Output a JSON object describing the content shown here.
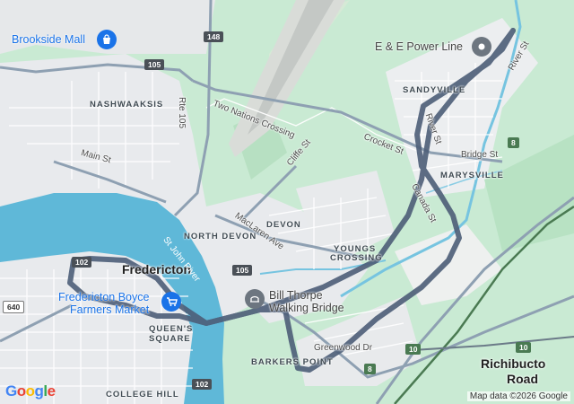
{
  "map": {
    "places": {
      "brookside_mall": "Brookside Mall",
      "ee_power_line": "E & E Power Line",
      "fredericton_boyce_line1": "Fredericton Boyce",
      "fredericton_boyce_line2": "Farmers Market",
      "bill_thorpe_line1": "Bill Thorpe",
      "bill_thorpe_line2": "Walking Bridge"
    },
    "areas": {
      "nashwaaksis": "NASHWAAKSIS",
      "north_devon": "NORTH DEVON",
      "devon": "DEVON",
      "youngs_crossing_1": "YOUNGS",
      "youngs_crossing_2": "CROSSING",
      "queens_square_1": "QUEEN'S",
      "queens_square_2": "SQUARE",
      "barkers_point": "BARKERS POINT",
      "college_hill": "COLLEGE HILL",
      "sandyville": "SANDYVILLE",
      "marysville": "MARYSVILLE",
      "fredericton": "Fredericton",
      "richibucto_road_1": "Richibucto",
      "richibucto_road_2": "Road"
    },
    "streets": {
      "two_nations": "Two Nations Crossing",
      "main_st": "Main St",
      "rte105": "Rte 105",
      "cliffe_st": "Cliffe St",
      "crocket_st": "Crocket St",
      "maclaren_ave": "MacLaren Ave",
      "river_st_1": "River St",
      "river_st_2": "River St",
      "canada_st": "Canada St",
      "bridge_st": "Bridge St",
      "greenwood_dr": "Greenwood Dr",
      "st_john_river": "St John River"
    },
    "shields": {
      "s148": "148",
      "s105_top": "105",
      "s105_mid": "105",
      "s102_top": "102",
      "s102_bottom": "102",
      "s640": "640",
      "s8_top": "8",
      "s8_bottom": "8",
      "s10_a": "10",
      "s10_b": "10"
    },
    "attribution": "Map data ©2026 Google",
    "logo": "Google",
    "colors": {
      "park": "#c9ead3",
      "water": "#5fb8d8",
      "route": "#4d5e78",
      "poi_blue": "#1a73e8",
      "poi_gray": "#6d7680"
    },
    "icons": {
      "brookside_mall": "shopping-bag-icon",
      "farmers_market": "shopping-cart-icon",
      "walking_bridge": "park-icon",
      "power_line": "pin-icon"
    }
  }
}
